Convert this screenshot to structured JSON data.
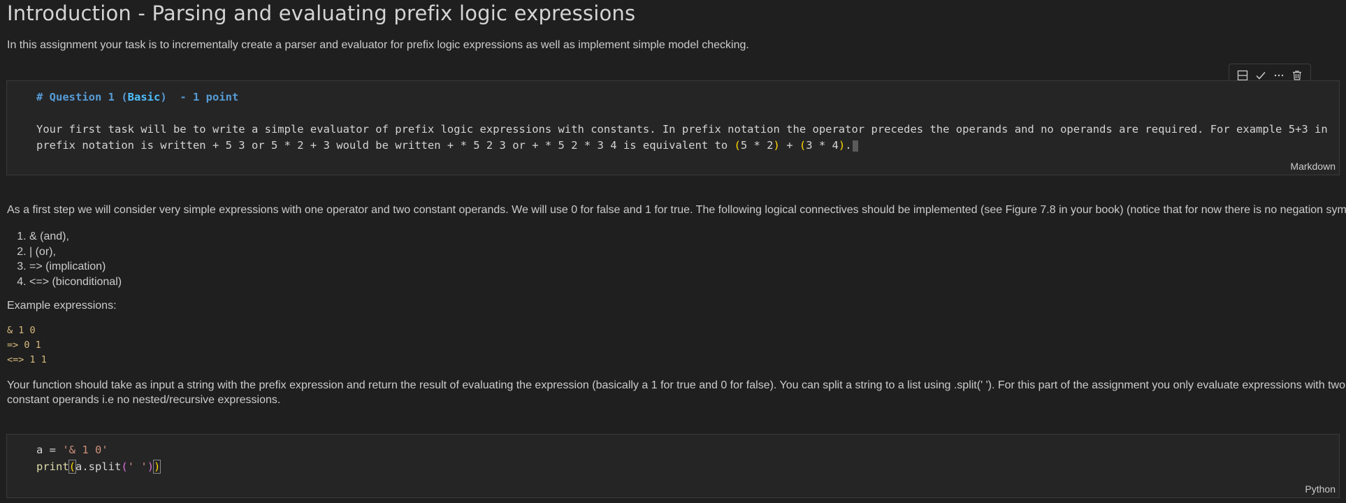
{
  "page": {
    "title": "Introduction - Parsing and evaluating prefix logic expressions",
    "intro": "In this assignment your task is to incrementally create a parser and evaluator for prefix logic expressions as well as implement simple model checking."
  },
  "toolbar": {
    "icons": [
      "split-cell-icon",
      "checkmark-icon",
      "more-icon",
      "delete-icon"
    ]
  },
  "markdown_cell": {
    "heading_hash": "# Question 1 (",
    "heading_basic": "Basic",
    "heading_close": ")",
    "heading_points": "- 1 point",
    "line1": "Your first task will be to write a simple evaluator of prefix logic expressions with constants. In prefix notation the operator precedes the operands and no operands are required. For example 5+3 in",
    "line2_a": "prefix notation is written + 5 3 or 5 * 2 + 3 would be written + * 5 2 3 or + * 5 2 * 3 4 is equivalent to ",
    "line2_p1_open": "(",
    "line2_p1_body": "5 * 2",
    "line2_p1_close": ")",
    "line2_plus": " + ",
    "line2_p2_open": "(",
    "line2_p2_body": "3 * 4",
    "line2_p2_close": ")",
    "line2_end": ".",
    "lang": "Markdown"
  },
  "body": {
    "first_step": "As a first step we will consider very simple expressions with one operator and two constant operands. We will use 0 for false and 1 for true. The following logical connectives should be implemented (see Figure 7.8 in your book) (notice that for now there is no negation symbol ~):",
    "connectives": [
      "& (and),",
      "| (or),",
      "=> (implication)",
      "<=> (biconditional)"
    ],
    "example_label": "Example expressions:",
    "examples": [
      "& 1 0",
      "=> 0 1",
      "<=> 1 1"
    ],
    "function_para_1": "Your function should take as input a string with the prefix expression and return the result of evaluating the expression (basically a 1 for true and 0 for false). You can split a string to a list using .split(' '). For this part of the assignment you only evaluate expressions with two",
    "function_para_2": "constant operands i.e no nested/recursive expressions."
  },
  "python_cell": {
    "line1_var": "a = ",
    "line1_str": "'& 1 0'",
    "line2_fn": "print",
    "line2_open": "(",
    "line2_arg": "a.split",
    "line2_inner_open": "(",
    "line2_inner_str": "' '",
    "line2_inner_close": ")",
    "line2_close": ")",
    "lang": "Python"
  }
}
